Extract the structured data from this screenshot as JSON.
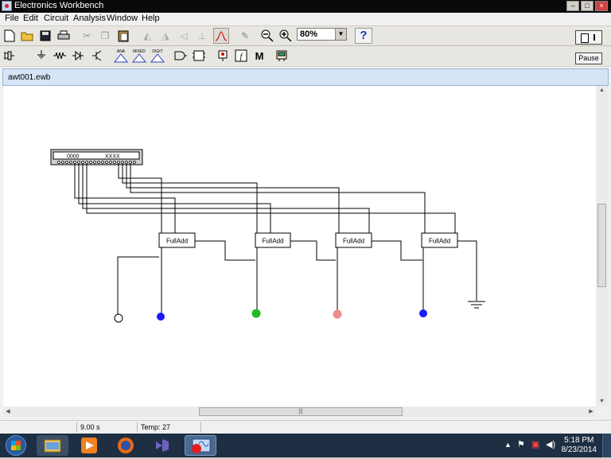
{
  "app": {
    "title": "Electronics Workbench"
  },
  "menu": [
    "File",
    "Edit",
    "Circuit",
    "Analysis",
    "Window",
    "Help"
  ],
  "toolbar": {
    "zoom": "80%",
    "help_label": "?",
    "pause_label": "Pause"
  },
  "parts_bin": {
    "ana_label": "ANA",
    "mixed_label": "MIXED",
    "digit_label": "DIGIT",
    "fcn_label": "f",
    "misc_label": "M"
  },
  "document": {
    "name": "awt001.ewb"
  },
  "circuit": {
    "word_generator": {
      "left_display": "0000",
      "right_display": "XXXX"
    },
    "adders": [
      "FullAdd",
      "FullAdd",
      "FullAdd",
      "FullAdd"
    ],
    "probe_colors": {
      "blue": "#1a1aff",
      "green": "#22bb22",
      "pink": "#f08a8a",
      "white": "#ffffff"
    }
  },
  "status": {
    "time": "9.00 s",
    "temp": "Temp:  27"
  },
  "taskbar": {
    "time": "5:18 PM",
    "date": "8/23/2014"
  }
}
